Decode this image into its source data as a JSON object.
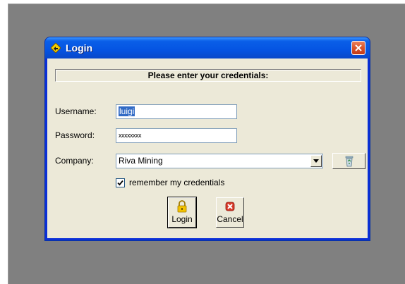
{
  "window": {
    "title": "Login",
    "title_icon": "diamond-arrow-icon",
    "close_icon": "close-icon"
  },
  "banner": {
    "text": "Please enter your credentials:"
  },
  "form": {
    "username_label": "Username:",
    "username_value": "luigi",
    "password_label": "Password:",
    "password_value": "xxxxxxxx",
    "company_label": "Company:",
    "company_value": "Riva Mining",
    "remember_label": "remember my credentials",
    "remember_checked": true
  },
  "buttons": {
    "login_label": "Login",
    "cancel_label": "Cancel",
    "login_icon": "padlock-icon",
    "cancel_icon": "red-x-icon",
    "delete_icon": "recycle-bin-icon"
  },
  "colors": {
    "titlebar": "#0554e2",
    "client_bg": "#ece9d8",
    "backdrop": "#808080",
    "selection": "#316ac5",
    "close_button": "#d9542b"
  }
}
